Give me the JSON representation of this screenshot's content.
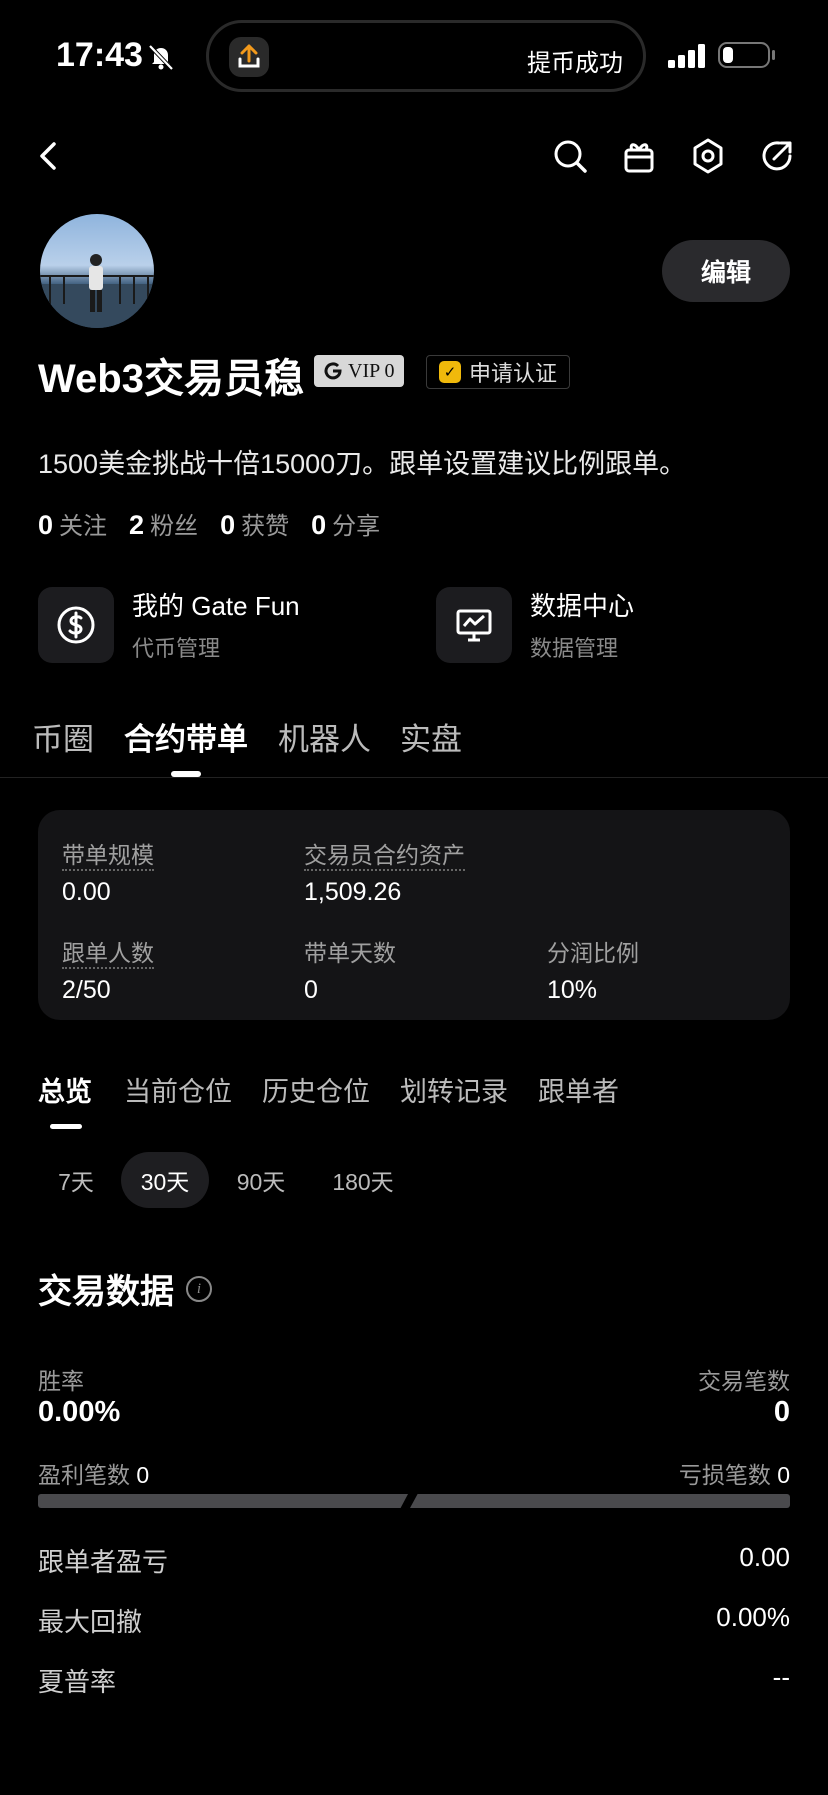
{
  "status_bar": {
    "time": "17:43",
    "island_text": "提币成功"
  },
  "profile": {
    "edit_label": "编辑",
    "name": "Web3交易员稳",
    "vip_label": "VIP 0",
    "apply_label": "申请认证",
    "bio": "1500美金挑战十倍15000刀。跟单设置建议比例跟单。",
    "stats": [
      {
        "value": "0",
        "label": "关注"
      },
      {
        "value": "2",
        "label": "粉丝"
      },
      {
        "value": "0",
        "label": "获赞"
      },
      {
        "value": "0",
        "label": "分享"
      }
    ]
  },
  "shortcuts": [
    {
      "title": "我的 Gate Fun",
      "subtitle": "代币管理",
      "icon": "dollar-coin-icon"
    },
    {
      "title": "数据中心",
      "subtitle": "数据管理",
      "icon": "chart-monitor-icon"
    }
  ],
  "tabs": [
    "币圈",
    "合约带单",
    "机器人",
    "实盘"
  ],
  "card": {
    "scale_label": "带单规模",
    "scale_value": "0.00",
    "assets_label": "交易员合约资产",
    "assets_value": "1,509.26",
    "followers_label": "跟单人数",
    "followers_value": "2/50",
    "days_label": "带单天数",
    "days_value": "0",
    "share_label": "分润比例",
    "share_value": "10%"
  },
  "sub_tabs": [
    "总览",
    "当前仓位",
    "历史仓位",
    "划转记录",
    "跟单者"
  ],
  "periods": [
    "7天",
    "30天",
    "90天",
    "180天"
  ],
  "trade": {
    "title": "交易数据",
    "win_rate_label": "胜率",
    "win_rate_value": "0.00%",
    "trades_label": "交易笔数",
    "trades_value": "0",
    "profit_count_label": "盈利笔数",
    "profit_count_value": "0",
    "loss_count_label": "亏损笔数",
    "loss_count_value": "0",
    "rows": [
      {
        "label": "跟单者盈亏",
        "value": "0.00"
      },
      {
        "label": "最大回撤",
        "value": "0.00%"
      },
      {
        "label": "夏普率",
        "value": "--"
      }
    ]
  }
}
